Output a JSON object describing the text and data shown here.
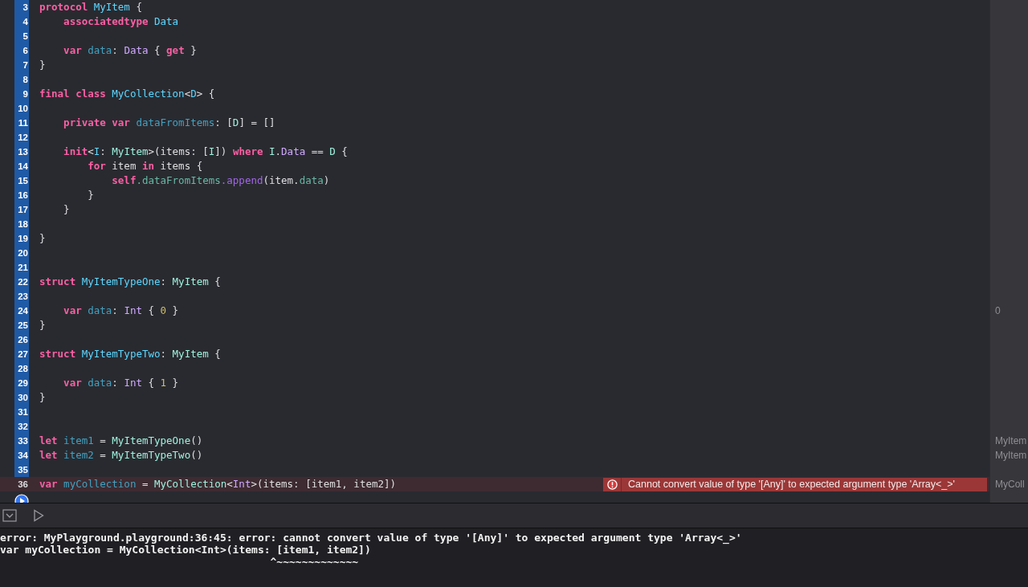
{
  "editor": {
    "lines": [
      {
        "number": "3",
        "executed": true,
        "tokens": [
          {
            "kind": "kw",
            "t": "protocol "
          },
          {
            "kind": "decl",
            "t": "MyItem"
          },
          {
            "kind": "p",
            "t": " {"
          }
        ]
      },
      {
        "number": "4",
        "executed": true,
        "tokens": [
          {
            "kind": "kw",
            "t": "    associatedtype "
          },
          {
            "kind": "decl",
            "t": "Data"
          }
        ]
      },
      {
        "number": "5",
        "executed": true
      },
      {
        "number": "6",
        "executed": true,
        "tokens": [
          {
            "kind": "kw",
            "t": "    var "
          },
          {
            "kind": "var",
            "t": "data"
          },
          {
            "kind": "p",
            "t": ": "
          },
          {
            "kind": "type",
            "t": "Data"
          },
          {
            "kind": "p",
            "t": " { "
          },
          {
            "kind": "kw",
            "t": "get"
          },
          {
            "kind": "p",
            "t": " }"
          }
        ]
      },
      {
        "number": "7",
        "executed": true,
        "tokens": [
          {
            "kind": "p",
            "t": "}"
          }
        ]
      },
      {
        "number": "8",
        "executed": true
      },
      {
        "number": "9",
        "executed": true,
        "tokens": [
          {
            "kind": "kw",
            "t": "final class "
          },
          {
            "kind": "decl",
            "t": "MyCollection"
          },
          {
            "kind": "p",
            "t": "<"
          },
          {
            "kind": "decl",
            "t": "D"
          },
          {
            "kind": "p",
            "t": "> {"
          }
        ]
      },
      {
        "number": "10",
        "executed": true
      },
      {
        "number": "11",
        "executed": true,
        "tokens": [
          {
            "kind": "kw",
            "t": "    private var "
          },
          {
            "kind": "var",
            "t": "dataFromItems"
          },
          {
            "kind": "p",
            "t": ": ["
          },
          {
            "kind": "proj",
            "t": "D"
          },
          {
            "kind": "p",
            "t": "] = []"
          }
        ]
      },
      {
        "number": "12",
        "executed": true
      },
      {
        "number": "13",
        "executed": true,
        "tokens": [
          {
            "kind": "kw",
            "t": "    init"
          },
          {
            "kind": "p",
            "t": "<"
          },
          {
            "kind": "decl",
            "t": "I"
          },
          {
            "kind": "p",
            "t": ": "
          },
          {
            "kind": "proj",
            "t": "MyItem"
          },
          {
            "kind": "p",
            "t": ">(items: ["
          },
          {
            "kind": "proj",
            "t": "I"
          },
          {
            "kind": "p",
            "t": "]) "
          },
          {
            "kind": "kw",
            "t": "where "
          },
          {
            "kind": "proj",
            "t": "I"
          },
          {
            "kind": "p",
            "t": "."
          },
          {
            "kind": "type",
            "t": "Data"
          },
          {
            "kind": "p",
            "t": " == "
          },
          {
            "kind": "proj",
            "t": "D"
          },
          {
            "kind": "p",
            "t": " {"
          }
        ]
      },
      {
        "number": "14",
        "executed": true,
        "tokens": [
          {
            "kind": "kw",
            "t": "        for"
          },
          {
            "kind": "p",
            "t": " item "
          },
          {
            "kind": "kw",
            "t": "in"
          },
          {
            "kind": "p",
            "t": " items {"
          }
        ]
      },
      {
        "number": "15",
        "executed": true,
        "tokens": [
          {
            "kind": "kw",
            "t": "            self"
          },
          {
            "kind": "prop",
            "t": ".dataFromItems"
          },
          {
            "kind": "method",
            "t": ".append"
          },
          {
            "kind": "p",
            "t": "(item."
          },
          {
            "kind": "prop",
            "t": "data"
          },
          {
            "kind": "p",
            "t": ")"
          }
        ]
      },
      {
        "number": "16",
        "executed": true,
        "tokens": [
          {
            "kind": "p",
            "t": "        }"
          }
        ]
      },
      {
        "number": "17",
        "executed": true,
        "tokens": [
          {
            "kind": "p",
            "t": "    }"
          }
        ]
      },
      {
        "number": "18",
        "executed": true
      },
      {
        "number": "19",
        "executed": true,
        "tokens": [
          {
            "kind": "p",
            "t": "}"
          }
        ]
      },
      {
        "number": "20",
        "executed": true
      },
      {
        "number": "21",
        "executed": true
      },
      {
        "number": "22",
        "executed": true,
        "tokens": [
          {
            "kind": "kw",
            "t": "struct "
          },
          {
            "kind": "decl",
            "t": "MyItemTypeOne"
          },
          {
            "kind": "p",
            "t": ": "
          },
          {
            "kind": "proj",
            "t": "MyItem"
          },
          {
            "kind": "p",
            "t": " {"
          }
        ]
      },
      {
        "number": "23",
        "executed": true
      },
      {
        "number": "24",
        "executed": true,
        "result": "0",
        "tokens": [
          {
            "kind": "kw",
            "t": "    var "
          },
          {
            "kind": "var",
            "t": "data"
          },
          {
            "kind": "p",
            "t": ": "
          },
          {
            "kind": "type",
            "t": "Int"
          },
          {
            "kind": "p",
            "t": " { "
          },
          {
            "kind": "num",
            "t": "0"
          },
          {
            "kind": "p",
            "t": " }"
          }
        ]
      },
      {
        "number": "25",
        "executed": true,
        "tokens": [
          {
            "kind": "p",
            "t": "}"
          }
        ]
      },
      {
        "number": "26",
        "executed": true
      },
      {
        "number": "27",
        "executed": true,
        "tokens": [
          {
            "kind": "kw",
            "t": "struct "
          },
          {
            "kind": "decl",
            "t": "MyItemTypeTwo"
          },
          {
            "kind": "p",
            "t": ": "
          },
          {
            "kind": "proj",
            "t": "MyItem"
          },
          {
            "kind": "p",
            "t": " {"
          }
        ]
      },
      {
        "number": "28",
        "executed": true
      },
      {
        "number": "29",
        "executed": true,
        "tokens": [
          {
            "kind": "kw",
            "t": "    var "
          },
          {
            "kind": "var",
            "t": "data"
          },
          {
            "kind": "p",
            "t": ": "
          },
          {
            "kind": "type",
            "t": "Int"
          },
          {
            "kind": "p",
            "t": " { "
          },
          {
            "kind": "num",
            "t": "1"
          },
          {
            "kind": "p",
            "t": " }"
          }
        ]
      },
      {
        "number": "30",
        "executed": true,
        "tokens": [
          {
            "kind": "p",
            "t": "}"
          }
        ]
      },
      {
        "number": "31",
        "executed": true
      },
      {
        "number": "32",
        "executed": true
      },
      {
        "number": "33",
        "executed": true,
        "result": "MyItem",
        "tokens": [
          {
            "kind": "kw",
            "t": "let "
          },
          {
            "kind": "var",
            "t": "item1"
          },
          {
            "kind": "p",
            "t": " = "
          },
          {
            "kind": "proj",
            "t": "MyItemTypeOne"
          },
          {
            "kind": "p",
            "t": "()"
          }
        ]
      },
      {
        "number": "34",
        "executed": true,
        "result": "MyItem",
        "tokens": [
          {
            "kind": "kw",
            "t": "let "
          },
          {
            "kind": "var",
            "t": "item2"
          },
          {
            "kind": "p",
            "t": " = "
          },
          {
            "kind": "proj",
            "t": "MyItemTypeTwo"
          },
          {
            "kind": "p",
            "t": "()"
          }
        ]
      },
      {
        "number": "35",
        "executed": true
      },
      {
        "number": "36",
        "executed": false,
        "result": "MyColl",
        "error": "Cannot convert value of type '[Any]' to expected argument type 'Array<_>'",
        "tokens": [
          {
            "kind": "kw",
            "t": "var "
          },
          {
            "kind": "var",
            "t": "myCollection"
          },
          {
            "kind": "p",
            "t": " = "
          },
          {
            "kind": "proj",
            "t": "MyCollection"
          },
          {
            "kind": "p",
            "t": "<"
          },
          {
            "kind": "type",
            "t": "Int"
          },
          {
            "kind": "p",
            "t": ">(items: [item1, item2])"
          }
        ]
      }
    ]
  },
  "console": {
    "lines": [
      "error: MyPlayground.playground:36:45: error: cannot convert value of type '[Any]' to expected argument type 'Array<_>'",
      "var myCollection = MyCollection<Int>(items: [item1, item2])",
      "                                           ^~~~~~~~~~~~~~"
    ]
  }
}
